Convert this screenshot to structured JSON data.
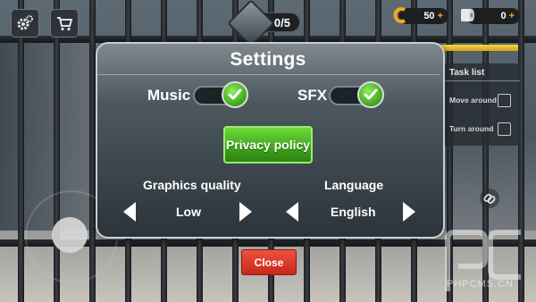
{
  "hud": {
    "counter": "0/5",
    "coins": "50",
    "coins_plus": "+",
    "paper": "0",
    "paper_plus": "+",
    "progress_fraction": 0.98
  },
  "task_list": {
    "title": "Task list",
    "items": [
      {
        "label": "Move around",
        "checked": false
      },
      {
        "label": "Turn around",
        "checked": false
      }
    ]
  },
  "settings": {
    "title": "Settings",
    "music_label": "Music",
    "music_on": true,
    "sfx_label": "SFX",
    "sfx_on": true,
    "privacy_label": "Privacy policy",
    "graphics_label": "Graphics quality",
    "graphics_value": "Low",
    "language_label": "Language",
    "language_value": "English",
    "close_label": "Close"
  },
  "watermark_text": "PHPCMS.CN",
  "colors": {
    "accent_green": "#3fa31c",
    "close_red": "#d8301f",
    "coin_orange": "#f4a51f"
  },
  "icons": [
    "gear-icon",
    "cart-icon",
    "printer-icon",
    "coin-icon",
    "toilet-paper-icon",
    "check-icon",
    "chain-icon"
  ]
}
